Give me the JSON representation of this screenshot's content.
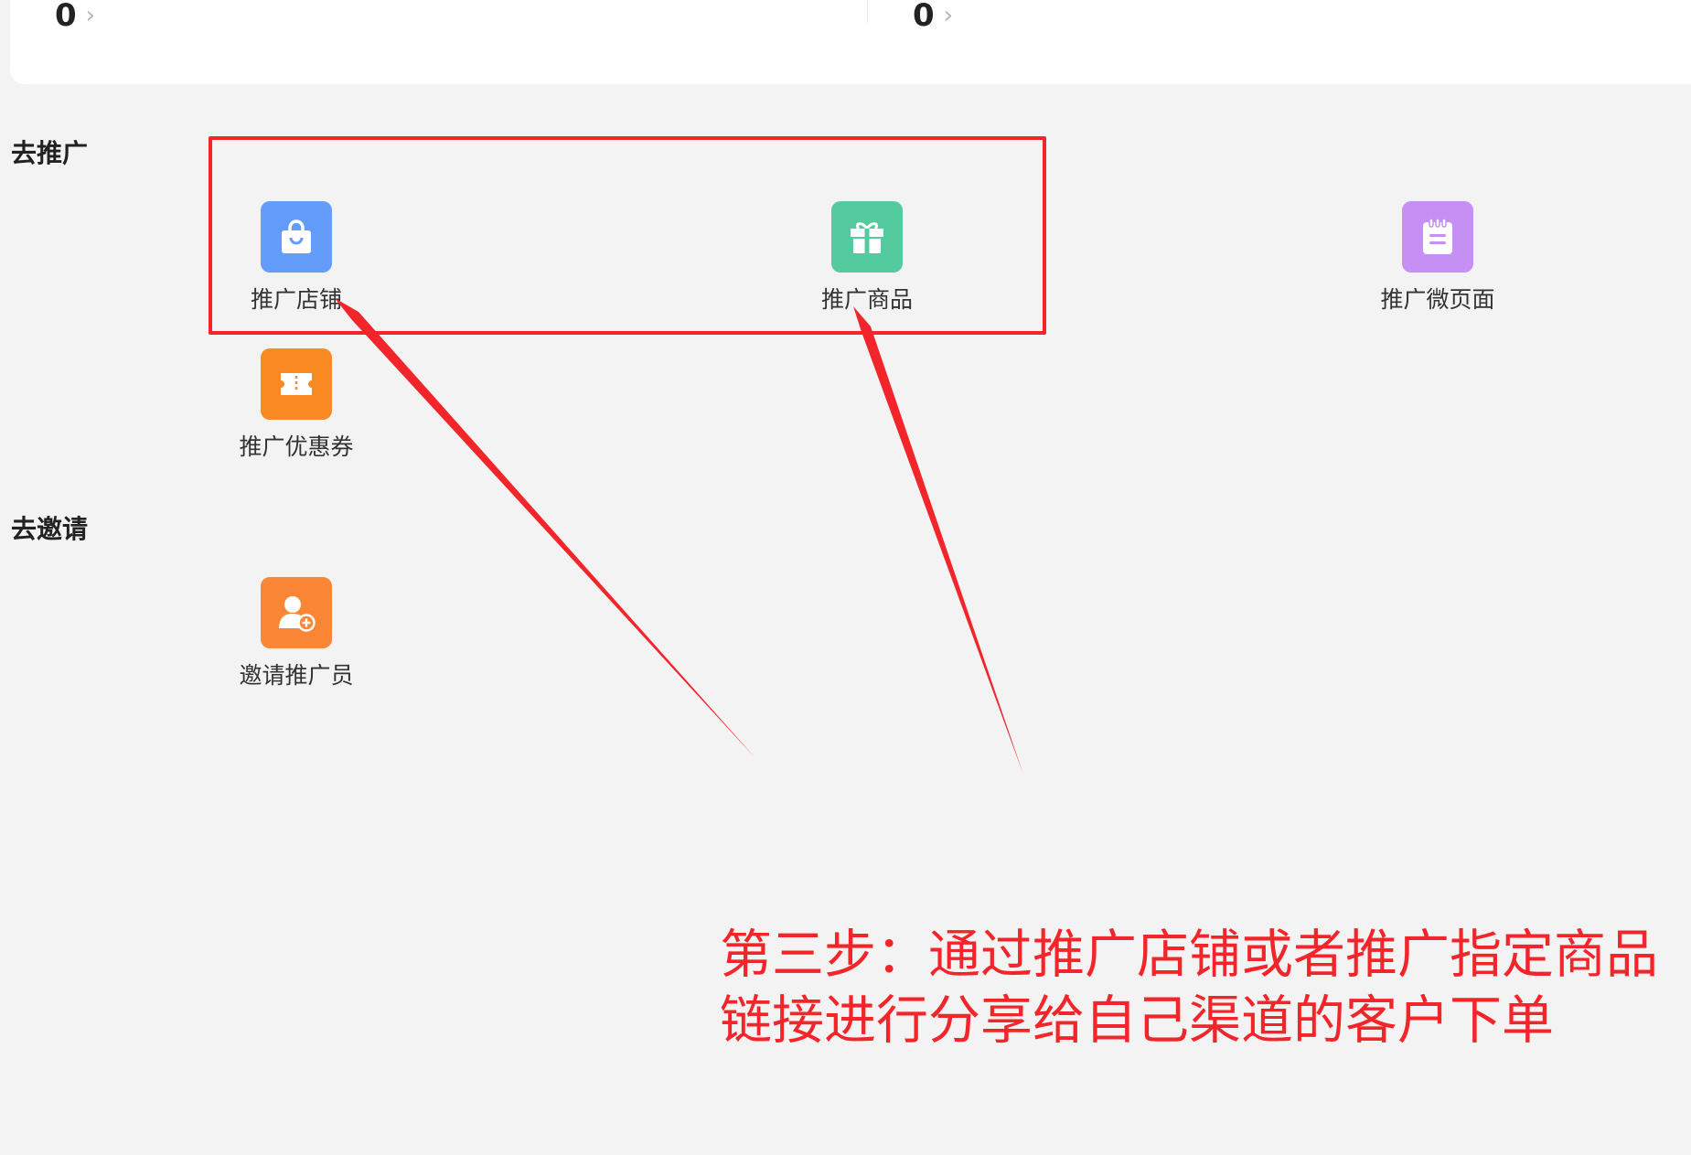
{
  "stats": [
    {
      "value": "0"
    },
    {
      "value": "0"
    }
  ],
  "chevron": "›",
  "sections": {
    "promote": {
      "title": "去推广",
      "items": [
        {
          "label": "推广店铺",
          "icon": "shopping-bag-icon",
          "color": "#639cfb"
        },
        {
          "label": "推广商品",
          "icon": "gift-icon",
          "color": "#54cb9f"
        },
        {
          "label": "推广微页面",
          "icon": "notepad-icon",
          "color": "#c58ff4"
        },
        {
          "label": "推广优惠券",
          "icon": "ticket-icon",
          "color": "#fa8b23"
        }
      ]
    },
    "invite": {
      "title": "去邀请",
      "items": [
        {
          "label": "邀请推广员",
          "icon": "add-user-icon",
          "color": "#fa8636"
        }
      ]
    }
  },
  "annotation": {
    "caption_line1": "第三步：通过推广店铺或者推广指定商品",
    "caption_line2": "链接进行分享给自己渠道的客户下单",
    "color": "#f2262a"
  }
}
